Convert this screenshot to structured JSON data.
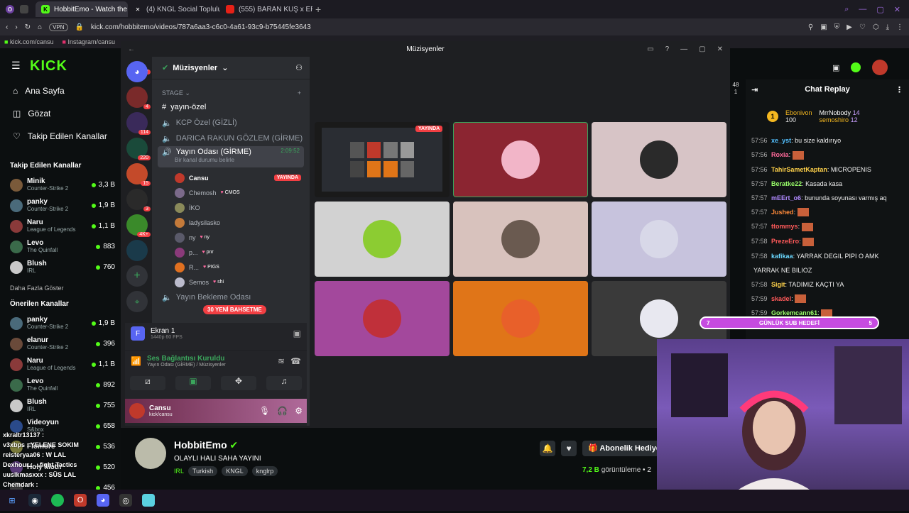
{
  "browser": {
    "tabs": [
      {
        "label": "HobbitEmo - Watch the VO",
        "active": true
      },
      {
        "label": "(4) KNGL Social Topluluk",
        "active": false
      },
      {
        "label": "(555) BARAN KUŞ x ERAY",
        "active": false
      }
    ],
    "url": "kick.com/hobbitemo/videos/787a6aa3-c6c0-4a61-93c9-b75445fe3643",
    "vpn": "VPN",
    "bookmarks": [
      "kick.com/cansu",
      "Instagram/cansu"
    ]
  },
  "kick": {
    "logo": "KICK",
    "nav": [
      {
        "label": "Ana Sayfa",
        "icon": "home-icon"
      },
      {
        "label": "Gözat",
        "icon": "browse-icon"
      },
      {
        "label": "Takip Edilen Kanallar",
        "icon": "heart-icon"
      }
    ],
    "followed_title": "Takip Edilen Kanallar",
    "followed": [
      {
        "name": "Minik",
        "game": "Counter-Strike 2",
        "viewers": "3,3 B",
        "color": "#7a5a3a"
      },
      {
        "name": "panky",
        "game": "Counter-Strike 2",
        "viewers": "1,9 B",
        "color": "#4a6a7a"
      },
      {
        "name": "Naru",
        "game": "League of Legends",
        "viewers": "1,1 B",
        "color": "#8a3a3a"
      },
      {
        "name": "Levo",
        "game": "The Quinfall",
        "viewers": "883",
        "color": "#3a6a4a"
      },
      {
        "name": "Blush",
        "game": "IRL",
        "viewers": "760",
        "color": "#c9c9c9"
      }
    ],
    "show_more": "Daha Fazla Göster",
    "recommended_title": "Önerilen Kanallar",
    "recommended": [
      {
        "name": "panky",
        "game": "Counter-Strike 2",
        "viewers": "1,9 B",
        "color": "#4a6a7a"
      },
      {
        "name": "elanur",
        "game": "Counter-Strike 2",
        "viewers": "396",
        "color": "#6a4a3a"
      },
      {
        "name": "Naru",
        "game": "League of Legends",
        "viewers": "1,1 B",
        "color": "#8a3a3a"
      },
      {
        "name": "Levo",
        "game": "The Quinfall",
        "viewers": "892",
        "color": "#3a6a4a"
      },
      {
        "name": "Blush",
        "game": "IRL",
        "viewers": "755",
        "color": "#c9c9c9"
      },
      {
        "name": "Videoyun",
        "game": "S&box",
        "viewers": "658",
        "color": "#2a4a8a"
      },
      {
        "name": "Flomore",
        "game": "",
        "viewers": "536",
        "color": "#7a7a3a"
      },
      {
        "name": "Holy Moth",
        "game": "",
        "viewers": "520",
        "color": "#5a3a7a"
      },
      {
        "name": "",
        "game": "",
        "viewers": "456",
        "color": "#3a3a3a"
      }
    ],
    "overlay_chat": [
      "xkraltr13137 :",
      "v3xbps : YELENE SOKIM",
      "reisteryaa06 : W LAL",
      "Dexhour : ...fight Tactics",
      "uuslkmasxxx : SÜS LAL",
      "Chemdark :"
    ],
    "streamer": "HobbitEmo",
    "stream_title": "OLAYLI HALI SAHA YAYINI",
    "tags": [
      "IRL",
      "Turkish",
      "KNGL",
      "knglrp"
    ],
    "views_num": "7,2 B",
    "views_label": "görüntüleme",
    "views_extra": "2",
    "subscribe": "Abonelik Hediye"
  },
  "discord": {
    "window_title": "Müzisyenler",
    "server_name": "Müzisyenler",
    "server_badges": [
      "87",
      "4",
      "114",
      "220",
      "15",
      "3",
      "4K+"
    ],
    "category": "STAGE",
    "channels": [
      {
        "name": "yayın-özel",
        "type": "text"
      },
      {
        "name": "KCP Özel (GİZLİ)",
        "type": "voice"
      },
      {
        "name": "DARICA RAKUN GÖZLEM (GİRME)",
        "type": "voice"
      },
      {
        "name": "Yayın Odası (GİRME)",
        "type": "voice",
        "timer": "2:09:52",
        "status": "Bir kanal durumu belirle"
      }
    ],
    "voice_users": [
      {
        "name": "Cansu",
        "tag": "",
        "live": "YAYINDA",
        "color": "#c0392b"
      },
      {
        "name": "Chemosh",
        "tag": "CMOS",
        "live": "",
        "color": "#7b6a8a"
      },
      {
        "name": "İKO",
        "tag": "",
        "live": "",
        "color": "#8a8a5a"
      },
      {
        "name": "ladysilasko",
        "tag": "",
        "live": "",
        "color": "#c47a3a"
      },
      {
        "name": "ny",
        "tag": "ny",
        "live": "",
        "color": "#5a5a6a"
      },
      {
        "name": "p...",
        "tag": "pnr",
        "live": "",
        "color": "#8a3a7a"
      },
      {
        "name": "R...",
        "tag": "PIGS",
        "live": "",
        "color": "#e07020"
      },
      {
        "name": "Semos",
        "tag": "shi",
        "live": "",
        "color": "#bbbbcc"
      }
    ],
    "next_channel": "Yayın Bekleme Odası",
    "new_messages": "30 YENİ BAHSETME",
    "screen_share": {
      "title": "Ekran 1",
      "sub": "1440p 60 FPS"
    },
    "voice_connected": "Ses Bağlantısı Kuruldu",
    "voice_channel": "Yayın Odası (GİRME) / Müzisyenler",
    "user": {
      "name": "Cansu",
      "status": "kick/cansu"
    },
    "live_badge": "YAYINDA",
    "tiles": [
      {
        "bg": "#1a1a1a",
        "face": "screen"
      },
      {
        "bg": "#8b2531",
        "face": "#f2b5c8"
      },
      {
        "bg": "#d7c4c6",
        "face": "#2a2a2a"
      },
      {
        "bg": "#d2d2d2",
        "face": "#8ccc32"
      },
      {
        "bg": "#d8c2bd",
        "face": "#6a5a50"
      },
      {
        "bg": "#c7c3dd",
        "face": "#d8d8e8"
      },
      {
        "bg": "#a3489c",
        "face": "#c0303a"
      },
      {
        "bg": "#e07518",
        "face": "#e8602a"
      },
      {
        "bg": "#3a3a3a",
        "face": "#e8e8f0"
      }
    ]
  },
  "chat": {
    "title": "Chat Replay",
    "top": [
      {
        "rank": "1",
        "name": "Ebonivon",
        "value": "100"
      },
      {
        "rank": "",
        "name": "MrrNobody",
        "value": "14"
      },
      {
        "rank": "",
        "name": "semoshiro",
        "value": "12"
      }
    ],
    "messages": [
      {
        "time": "57:56",
        "user": "xe_yst",
        "text": "bu size kaldırıyo",
        "color": "#53c0ff"
      },
      {
        "time": "57:56",
        "user": "Roxia",
        "text": "[emote]",
        "color": "#ff6a9a"
      },
      {
        "time": "57:56",
        "user": "TahirSametKaptan",
        "text": "MICROPENIS",
        "color": "#ffd24a"
      },
      {
        "time": "57:57",
        "user": "Beratke22",
        "text": "Kasada kasa",
        "color": "#9aff6a"
      },
      {
        "time": "57:57",
        "user": "mEErt_o6",
        "text": "bununda soyunası varmış aq",
        "color": "#b08aff"
      },
      {
        "time": "57:57",
        "user": "Jushed",
        "text": "[emote]",
        "color": "#ff8a3a"
      },
      {
        "time": "57:57",
        "user": "ttommys",
        "text": "[emote]",
        "color": "#ff5a5a"
      },
      {
        "time": "57:58",
        "user": "PrezeEro",
        "text": "[emote]",
        "color": "#ff5a5a"
      },
      {
        "time": "57:58",
        "user": "kafikaa",
        "text": "YARRAK DEGIL PIPI O AMK",
        "color": "#6ad8ff"
      },
      {
        "time": "",
        "user": "",
        "text": "YARRAK NE BILIOZ",
        "color": "#fff"
      },
      {
        "time": "57:58",
        "user": "Sigit",
        "text": "TADIMIZ KAÇTI YA",
        "color": "#ffd24a"
      },
      {
        "time": "57:59",
        "user": "skadel",
        "text": "[emote]",
        "color": "#ff5a5a"
      },
      {
        "time": "57:59",
        "user": "Gorkemcann61",
        "text": "[emote]",
        "color": "#9aff6a"
      }
    ],
    "sub_goal": {
      "left": "7",
      "label": "GÜNLÜK SUB HEDEFİ",
      "right": "5"
    }
  },
  "right_meta": {
    "a": "48",
    "b": "1"
  }
}
